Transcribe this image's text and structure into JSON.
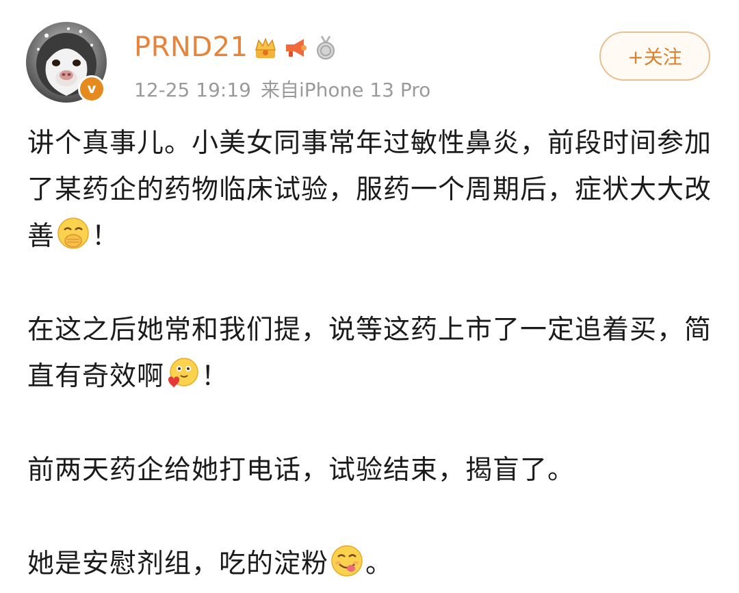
{
  "post": {
    "author": {
      "name": "PRND21",
      "avatar_icon": "husky-dog-avatar",
      "verified_icon": "verified-v-badge",
      "verified_glyph": "v",
      "badges": [
        "crown-vip-icon",
        "megaphone-icon",
        "silver-medal-icon"
      ]
    },
    "meta": {
      "date": "12-25 19:19",
      "source": "来自iPhone 13 Pro"
    },
    "follow_button": {
      "label": "+关注"
    },
    "paragraphs": [
      {
        "segments": [
          {
            "text": "讲个真事儿。小美女同事常年过敏性鼻炎，前段时间参加了某药企的药物临床试验，服药一个周期后，症状大大改善"
          },
          {
            "emoji": "covering-mouth-emoji"
          },
          {
            "text": "！"
          }
        ]
      },
      {
        "segments": [
          {
            "text": "在这之后她常和我们提，说等这药上市了一定追着买，简直有奇效啊"
          },
          {
            "emoji": "heart-hug-emoji"
          },
          {
            "text": "！"
          }
        ]
      },
      {
        "segments": [
          {
            "text": "前两天药企给她打电话，试验结束，揭盲了。"
          }
        ]
      },
      {
        "segments": [
          {
            "text": "她是安慰剂组，吃的淀粉"
          },
          {
            "emoji": "yummy-face-emoji"
          },
          {
            "text": "。"
          }
        ]
      }
    ]
  },
  "colors": {
    "username": "#e8833a",
    "meta": "#9a9a9a",
    "follow_border": "#e8c08f",
    "follow_text": "#d9822b",
    "verified_badge": "#e58a1f",
    "body_text": "#1b1b1b"
  }
}
